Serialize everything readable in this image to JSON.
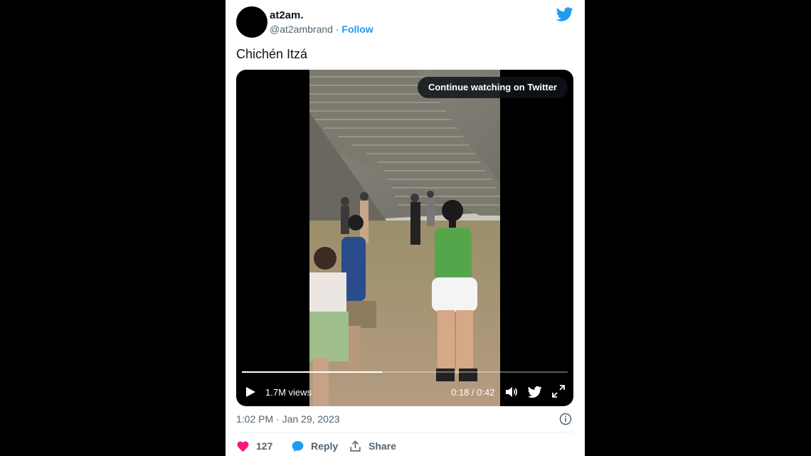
{
  "tweet": {
    "author_name": "at2am.",
    "handle": "@at2ambrand",
    "separator": " · ",
    "follow_label": "Follow",
    "text": "Chichén Itzá",
    "timestamp": "1:02 PM · Jan 29, 2023",
    "likes": "127",
    "reply_label": "Reply",
    "share_label": "Share"
  },
  "video": {
    "continue_label": "Continue watching on Twitter",
    "views": "1.7M views",
    "time": "0:18 / 0:42",
    "progress_fraction": 0.43
  },
  "colors": {
    "brand_blue": "#1d9bf0",
    "like_pink": "#f91880",
    "text_gray": "#536471"
  },
  "icons": [
    "twitter-bird-icon",
    "play-icon",
    "volume-icon",
    "twitter-icon",
    "fullscreen-icon",
    "info-icon",
    "heart-icon",
    "reply-icon",
    "share-icon"
  ]
}
